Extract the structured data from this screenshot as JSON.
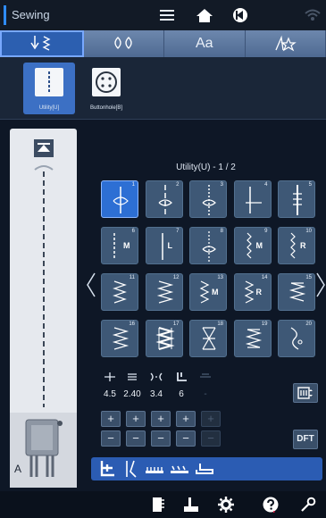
{
  "header": {
    "mode": "Sewing",
    "icons": [
      "menu-icon",
      "home-icon",
      "back-icon",
      "wifi-icon"
    ]
  },
  "category_tabs": [
    {
      "name": "utility-stitch-tab",
      "label": "",
      "active": true
    },
    {
      "name": "decorative-stitch-tab",
      "label": "",
      "active": false
    },
    {
      "name": "character-tab",
      "label": "Aa",
      "active": false
    },
    {
      "name": "favorite-tab",
      "label": "",
      "active": false
    }
  ],
  "subcategories": [
    {
      "label": "Utility[U]",
      "active": true,
      "icon": "straight-stitch-icon"
    },
    {
      "label": "Buttonhole[B]",
      "active": false,
      "icon": "button-icon"
    }
  ],
  "presser_foot_label": "A",
  "stitch_list": {
    "title": "Utility(U) - 1 / 2",
    "stitches": [
      {
        "num": "1",
        "mark": "",
        "active": true
      },
      {
        "num": "2",
        "mark": ""
      },
      {
        "num": "3",
        "mark": ""
      },
      {
        "num": "4",
        "mark": ""
      },
      {
        "num": "5",
        "mark": ""
      },
      {
        "num": "6",
        "mark": "M"
      },
      {
        "num": "7",
        "mark": "L"
      },
      {
        "num": "8",
        "mark": ""
      },
      {
        "num": "9",
        "mark": "M"
      },
      {
        "num": "10",
        "mark": "R"
      },
      {
        "num": "11",
        "mark": ""
      },
      {
        "num": "12",
        "mark": ""
      },
      {
        "num": "13",
        "mark": "M"
      },
      {
        "num": "14",
        "mark": "R"
      },
      {
        "num": "15",
        "mark": ""
      },
      {
        "num": "16",
        "mark": ""
      },
      {
        "num": "17",
        "mark": ""
      },
      {
        "num": "18",
        "mark": ""
      },
      {
        "num": "19",
        "mark": ""
      },
      {
        "num": "20",
        "mark": ""
      }
    ]
  },
  "params": [
    {
      "name": "needle-position",
      "value": "4.5",
      "enabled": true
    },
    {
      "name": "stitch-length",
      "value": "2.40",
      "enabled": true
    },
    {
      "name": "tension",
      "value": "3.4",
      "enabled": true
    },
    {
      "name": "presser-foot-pressure",
      "value": "6",
      "enabled": true
    },
    {
      "name": "unused",
      "value": "-",
      "enabled": false
    }
  ],
  "side_buttons": {
    "dft": "DFT"
  },
  "colors": {
    "accent": "#2e8cff",
    "active_tile": "#2d6fd4",
    "tile": "#3e5876",
    "background": "#0e1726"
  }
}
